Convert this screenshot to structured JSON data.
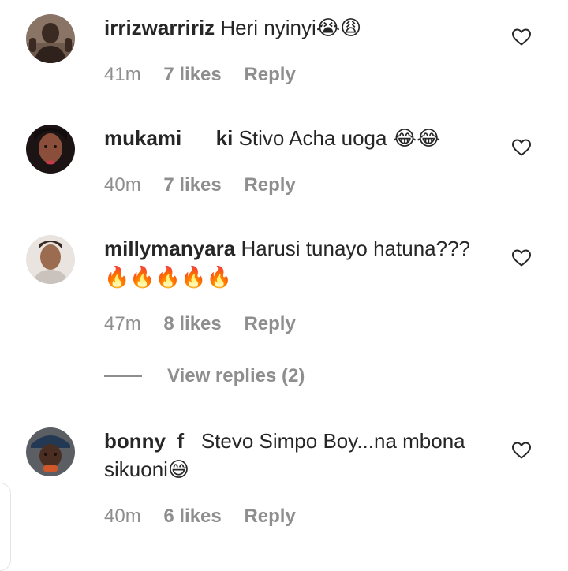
{
  "comments": [
    {
      "username": "irrizwarririz",
      "text": "Heri nyinyi😭😩",
      "time": "41m",
      "likes": "7 likes",
      "reply": "Reply"
    },
    {
      "username": "mukami___ki",
      "text": "Stivo Acha uoga 😂😂",
      "time": "40m",
      "likes": "7 likes",
      "reply": "Reply"
    },
    {
      "username": "millymanyara",
      "text": "Harusi tunayo hatuna??? 🔥🔥🔥🔥🔥",
      "time": "47m",
      "likes": "8 likes",
      "reply": "Reply"
    },
    {
      "username": "bonny_f_",
      "text": "Stevo Simpo Boy...na mbona sikuoni😅",
      "time": "40m",
      "likes": "6 likes",
      "reply": "Reply"
    }
  ],
  "view_replies": "View replies (2)",
  "icons": {
    "like": "heart-outline-icon"
  },
  "colors": {
    "text": "#262626",
    "secondary": "#8e8e8e",
    "background": "#ffffff"
  }
}
